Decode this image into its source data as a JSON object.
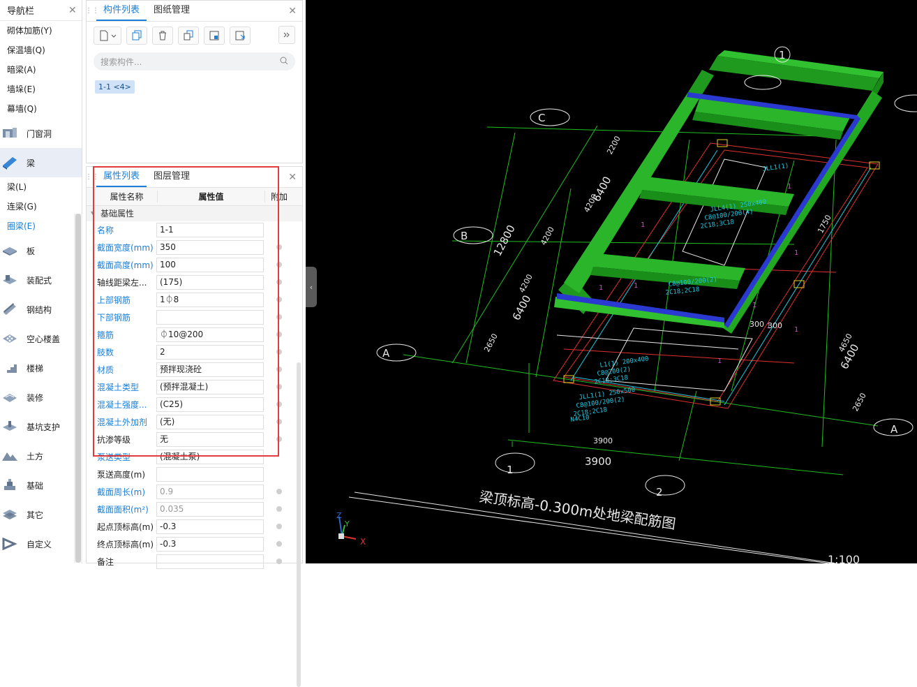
{
  "nav": {
    "title": "导航栏",
    "sub_items_top": [
      "砌体加筋(Y)",
      "保温墙(Q)",
      "暗梁(A)",
      "墙垛(E)",
      "幕墙(Q)"
    ],
    "categories_top": [
      {
        "label": "门窗洞",
        "icon": "door-window-icon"
      },
      {
        "label": "梁",
        "icon": "beam-icon"
      }
    ],
    "beam_sub_items": [
      "梁(L)",
      "连梁(G)",
      "圈梁(E)"
    ],
    "categories_bottom": [
      {
        "label": "板",
        "icon": "slab-icon"
      },
      {
        "label": "装配式",
        "icon": "prefab-icon"
      },
      {
        "label": "钢结构",
        "icon": "steel-icon"
      },
      {
        "label": "空心楼盖",
        "icon": "hollow-floor-icon"
      },
      {
        "label": "楼梯",
        "icon": "stairs-icon"
      },
      {
        "label": "装修",
        "icon": "decoration-icon"
      },
      {
        "label": "基坑支护",
        "icon": "pit-support-icon"
      },
      {
        "label": "土方",
        "icon": "earthwork-icon"
      },
      {
        "label": "基础",
        "icon": "foundation-icon"
      },
      {
        "label": "其它",
        "icon": "other-icon"
      },
      {
        "label": "自定义",
        "icon": "custom-icon"
      }
    ]
  },
  "component_panel": {
    "tabs": [
      "构件列表",
      "图纸管理"
    ],
    "search_placeholder": "搜索构件...",
    "chip": "1-1 <4>"
  },
  "property_panel": {
    "tabs": [
      "属性列表",
      "图层管理"
    ],
    "headers": {
      "name": "属性名称",
      "value": "属性值",
      "extra": "附加"
    },
    "group": "基础属性",
    "rows": [
      {
        "name": "名称",
        "value": "1-1",
        "link": true,
        "dot": false,
        "gray": false
      },
      {
        "name": "截面宽度(mm)",
        "value": "350",
        "link": true,
        "dot": true,
        "gray": false
      },
      {
        "name": "截面高度(mm)",
        "value": "100",
        "link": true,
        "dot": true,
        "gray": false
      },
      {
        "name": "轴线距梁左...",
        "value": "(175)",
        "link": false,
        "dot": true,
        "gray": false
      },
      {
        "name": "上部钢筋",
        "value": "1⏀8",
        "link": true,
        "dot": true,
        "gray": false
      },
      {
        "name": "下部钢筋",
        "value": "",
        "link": true,
        "dot": true,
        "gray": false
      },
      {
        "name": "箍筋",
        "value": "⏀10@200",
        "link": true,
        "dot": true,
        "gray": false
      },
      {
        "name": "肢数",
        "value": "2",
        "link": true,
        "dot": true,
        "gray": false
      },
      {
        "name": "材质",
        "value": "预拌现浇砼",
        "link": true,
        "dot": true,
        "gray": false
      },
      {
        "name": "混凝土类型",
        "value": "(预拌混凝土)",
        "link": true,
        "dot": true,
        "gray": false
      },
      {
        "name": "混凝土强度...",
        "value": "(C25)",
        "link": true,
        "dot": true,
        "gray": false
      },
      {
        "name": "混凝土外加剂",
        "value": "(无)",
        "link": true,
        "dot": true,
        "gray": false
      },
      {
        "name": "抗渗等级",
        "value": "无",
        "link": false,
        "dot": true,
        "gray": false
      },
      {
        "name": "泵送类型",
        "value": "(混凝土泵)",
        "link": true,
        "dot": false,
        "gray": false
      },
      {
        "name": "泵送高度(m)",
        "value": "",
        "link": false,
        "dot": false,
        "gray": false
      },
      {
        "name": "截面周长(m)",
        "value": "0.9",
        "link": true,
        "dot": true,
        "gray": true
      },
      {
        "name": "截面面积(m²)",
        "value": "0.035",
        "link": true,
        "dot": true,
        "gray": true
      },
      {
        "name": "起点顶标高(m)",
        "value": "-0.3",
        "link": false,
        "dot": true,
        "gray": false
      },
      {
        "name": "终点顶标高(m)",
        "value": "-0.3",
        "link": false,
        "dot": true,
        "gray": false
      },
      {
        "name": "备注",
        "value": "",
        "link": false,
        "dot": true,
        "gray": false
      }
    ]
  },
  "cad": {
    "axis_labels": [
      "1",
      "C",
      "B",
      "A",
      "1",
      "2",
      "A",
      "B",
      "C"
    ],
    "dims": [
      "6400",
      "12800",
      "6400",
      "3900",
      "3900",
      "6400",
      "2200",
      "4200",
      "4200",
      "2650",
      "300",
      "2650",
      "1750",
      "4650",
      "300",
      "6400",
      "3900"
    ],
    "beam_notes": [
      "JLL1(1)",
      "JLL4(1) 250x400",
      "C8@100/200(4)",
      "2C18;3C18",
      "C8@100/200(2)",
      "2C18;2C18",
      "L1(1) 200x400",
      "C8@200(2)",
      "2C18;3C18",
      "JLL1(1) 250x500",
      "C8@100/200(2)",
      "2C18;2C18",
      "N4C10"
    ],
    "drawing_title": "梁顶标高-0.300m处地梁配筋图",
    "scale": "1:100",
    "axes": {
      "x": "X",
      "y": "Y",
      "z": "Z"
    }
  }
}
